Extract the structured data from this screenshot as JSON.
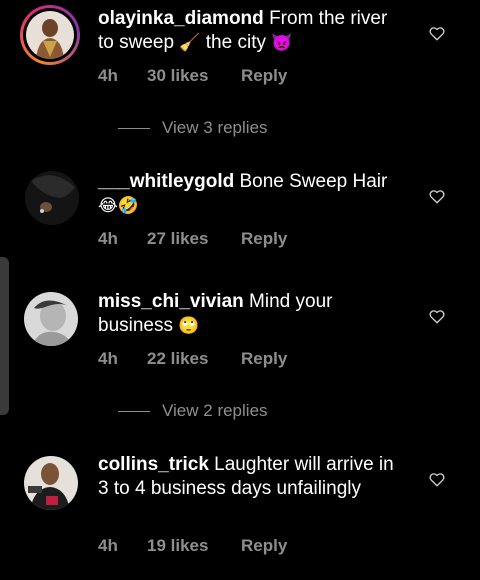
{
  "comments": [
    {
      "username": "olayinka_diamond",
      "text": "From the river to sweep",
      "emoji_1": "🧹",
      "text_2": "the city",
      "emoji_2": "👿",
      "time": "4h",
      "likes": "30 likes",
      "reply": "Reply",
      "view_replies": "View 3 replies"
    },
    {
      "username": "___whitleygold",
      "text": "Bone Sweep Hair",
      "emoji_1": "😂🤣",
      "time": "4h",
      "likes": "27 likes",
      "reply": "Reply"
    },
    {
      "username": "miss_chi_vivian",
      "text": "Mind your business",
      "emoji_1": "🙄",
      "time": "4h",
      "likes": "22 likes",
      "reply": "Reply",
      "view_replies": "View 2 replies"
    },
    {
      "username": "collins_trick",
      "text": "Laughter will arrive in 3 to 4 business days unfailingly",
      "time": "4h",
      "likes": "19 likes",
      "reply": "Reply"
    }
  ],
  "icons": {
    "like": "heart-outline-icon"
  },
  "colors": {
    "background": "#000000",
    "text": "#ffffff",
    "secondary": "#8e8e8e",
    "story_ring": "#dd2a7b"
  }
}
